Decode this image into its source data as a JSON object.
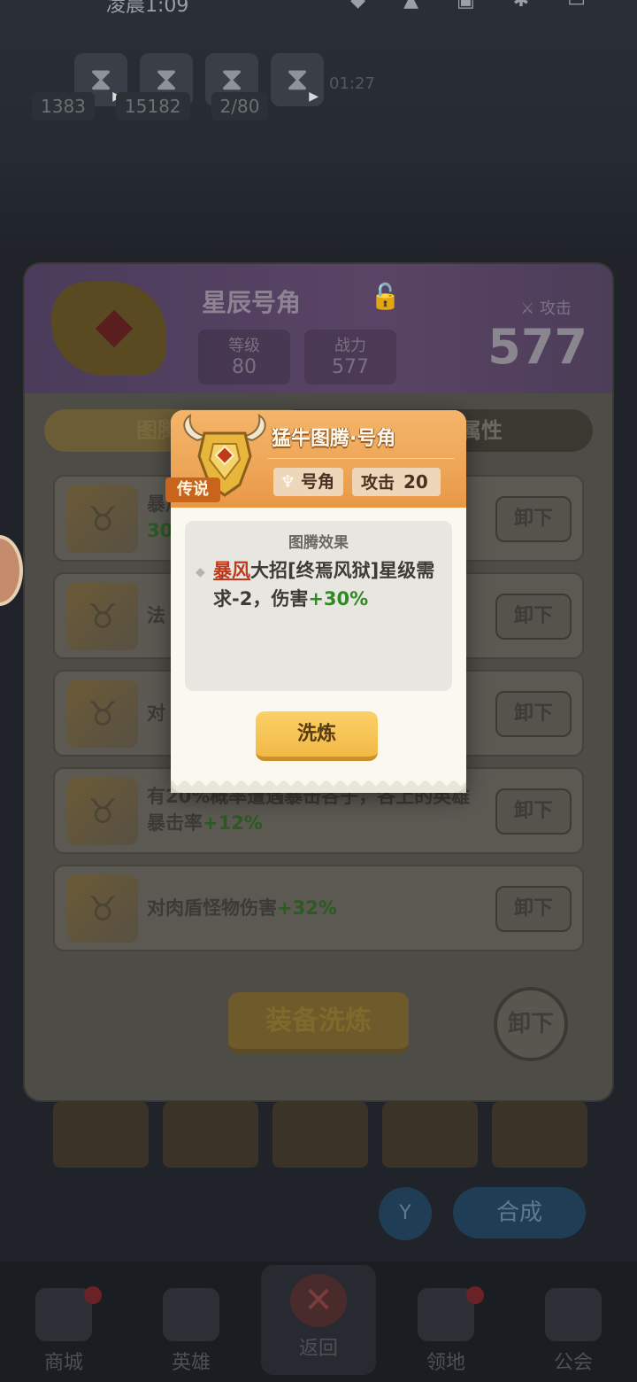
{
  "statusbar": {
    "time": "凌晨1:09",
    "icons": "◆ ▲ ▣ ✱ ▭"
  },
  "timers": [
    {
      "icon": "⧗",
      "play": "▶"
    },
    {
      "icon": "⧗",
      "play": "▶"
    },
    {
      "icon": "⧗",
      "play": "▶"
    },
    {
      "icon": "⧗",
      "play": "▶"
    }
  ],
  "resources": {
    "gems": "1383",
    "gold": "15182",
    "stamina": "2/80",
    "timer": "01:27"
  },
  "panel": {
    "title": "星辰号角",
    "lock_icon": "🔓",
    "level_label": "等级",
    "level_value": "80",
    "power_label": "战力",
    "power_value": "577",
    "attack_label": "攻击",
    "attack_value": "577",
    "tab_left": "图腾",
    "tab_right": "属性",
    "totems": [
      {
        "text": "暴风",
        "bonus": "30%",
        "button": "卸下"
      },
      {
        "text": "法",
        "bonus": "",
        "button": "卸下"
      },
      {
        "text": "对",
        "bonus": "",
        "button": "卸下"
      },
      {
        "text": "有20%概率遭遇暴击各子，各上的英雄暴击率",
        "bonus": "+12%",
        "button": "卸下"
      },
      {
        "text": "对肉盾怪物伤害",
        "bonus": "+32%",
        "button": "卸下"
      }
    ],
    "refine_button": "装备洗炼",
    "unequip_button": "卸下"
  },
  "popup": {
    "name": "猛牛图腾·号角",
    "rarity": "传说",
    "slot_label": "号角",
    "attack_label": "攻击",
    "attack_value": "20",
    "effect_title": "图腾效果",
    "effect_keyword": "暴风",
    "effect_text": "大招[终焉风狱]星级需求-2，伤害",
    "effect_bonus": "+30%",
    "wash_button": "洗炼"
  },
  "bottom_nav": [
    {
      "label": "商城",
      "badge": true
    },
    {
      "label": "英雄",
      "badge": false
    },
    {
      "label": "返回",
      "badge": false
    },
    {
      "label": "领地",
      "badge": true
    },
    {
      "label": "公会",
      "badge": false
    }
  ],
  "colors": {
    "popup_header": "#eea657",
    "rarity_legendary": "#c9641c",
    "keyword_red": "#c0391b",
    "bonus_green": "#2f8a24",
    "button_gold": "#f2b945"
  }
}
